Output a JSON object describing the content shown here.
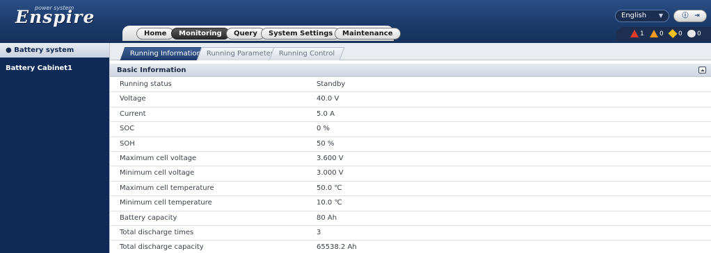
{
  "app": {
    "brand": "Enspire",
    "tagline": "power system"
  },
  "nav": {
    "tabs": [
      {
        "label": "Home",
        "active": false
      },
      {
        "label": "Monitoring",
        "active": true
      },
      {
        "label": "Query",
        "active": false
      },
      {
        "label": "System Settings",
        "active": false
      },
      {
        "label": "Maintenance",
        "active": false
      }
    ]
  },
  "header": {
    "language": "English",
    "info_icon": "info-icon",
    "logout_icon": "logout-icon"
  },
  "alarms": {
    "critical": "1",
    "major": "0",
    "minor": "0",
    "warning": "0"
  },
  "sidebar": {
    "items": [
      {
        "label": "Battery system",
        "selected": true
      },
      {
        "label": "Battery Cabinet1",
        "selected": false
      }
    ]
  },
  "subtabs": [
    {
      "label": "Running Information",
      "active": true
    },
    {
      "label": "Running Parameter",
      "active": false
    },
    {
      "label": "Running Control",
      "active": false
    }
  ],
  "section": {
    "title": "Basic Information"
  },
  "rows": [
    {
      "key": "Running status",
      "value": "Standby"
    },
    {
      "key": "Voltage",
      "value": "40.0  V"
    },
    {
      "key": "Current",
      "value": "5.0  A"
    },
    {
      "key": "SOC",
      "value": "0  %"
    },
    {
      "key": "SOH",
      "value": "50  %"
    },
    {
      "key": "Maximum cell voltage",
      "value": "3.600  V"
    },
    {
      "key": "Minimum cell voltage",
      "value": "3.000  V"
    },
    {
      "key": "Maximum cell temperature",
      "value": "50.0  ℃"
    },
    {
      "key": "Minimum cell temperature",
      "value": "10.0  ℃"
    },
    {
      "key": "Battery capacity",
      "value": "80  Ah"
    },
    {
      "key": "Total discharge times",
      "value": "3"
    },
    {
      "key": "Total discharge capacity",
      "value": "65538.2  Ah"
    }
  ],
  "colors": {
    "header_bg": "#1c3a6a",
    "sidebar_bg": "#0f2a57",
    "critical": "#e23b2a",
    "major": "#f29a1e",
    "minor": "#f2c21e"
  }
}
